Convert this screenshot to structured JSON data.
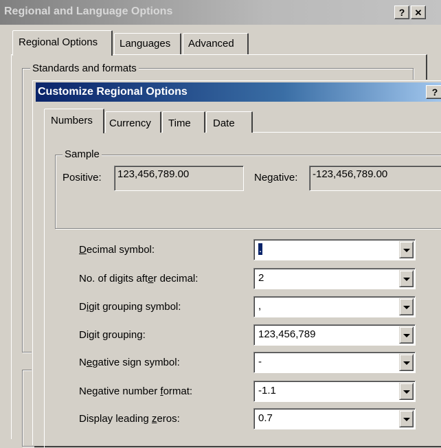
{
  "outer_window": {
    "title": "Regional and Language Options",
    "help_glyph": "?",
    "close_glyph": "✕",
    "tabs": [
      "Regional Options",
      "Languages",
      "Advanced"
    ],
    "group_title": "Standards and formats"
  },
  "dialog": {
    "title": "Customize Regional Options",
    "help_glyph": "?",
    "tabs": [
      "Numbers",
      "Currency",
      "Time",
      "Date"
    ],
    "sample": {
      "group_title": "Sample",
      "positive_label": "Positive:",
      "positive_value": "123,456,789.00",
      "negative_label": "Negative:",
      "negative_value": "-123,456,789.00"
    },
    "settings": [
      {
        "pre": "",
        "key": "D",
        "post": "ecimal symbol:",
        "value": "."
      },
      {
        "pre": "No. of digits aft",
        "key": "e",
        "post": "r decimal:",
        "value": "2"
      },
      {
        "pre": "D",
        "key": "i",
        "post": "git grouping symbol:",
        "value": ","
      },
      {
        "pre": "Di",
        "key": "g",
        "post": "it grouping:",
        "value": "123,456,789"
      },
      {
        "pre": "N",
        "key": "e",
        "post": "gative sign symbol:",
        "value": "-"
      },
      {
        "pre": "Negative number ",
        "key": "f",
        "post": "ormat:",
        "value": "-1.1"
      },
      {
        "pre": "Display leading ",
        "key": "z",
        "post": "eros:",
        "value": "0.7"
      }
    ]
  },
  "colors": {
    "face": "#d4d0c8",
    "active_title": "#0a246a",
    "inactive_title": "#808080"
  }
}
